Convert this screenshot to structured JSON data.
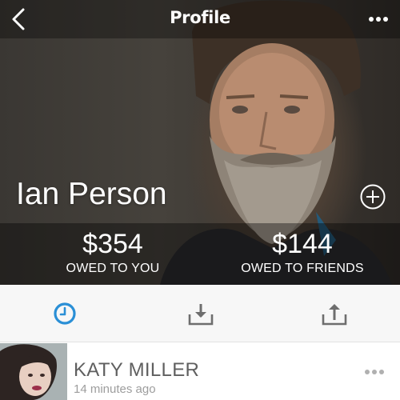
{
  "header": {
    "title": "Profile",
    "back_icon": "chevron-left-icon",
    "more_icon": "more-horizontal-icon"
  },
  "profile": {
    "name": "Ian Person",
    "add_icon": "plus-circle-icon",
    "owed_to_you": {
      "amount": "$354",
      "label": "OWED TO YOU"
    },
    "owed_to_friends": {
      "amount": "$144",
      "label": "OWED TO FRIENDS"
    }
  },
  "tabs": [
    {
      "id": "history",
      "icon": "clock-icon",
      "active": true
    },
    {
      "id": "received",
      "icon": "tray-download-icon",
      "active": false
    },
    {
      "id": "sent",
      "icon": "tray-upload-icon",
      "active": false
    }
  ],
  "list": {
    "items": [
      {
        "name": "KATY MILLER",
        "time": "14 minutes ago",
        "more_icon": "more-horizontal-icon"
      }
    ]
  },
  "colors": {
    "accent": "#2a8fd6",
    "icon_gray": "#6e6e6e",
    "tab_bar_bg": "#f7f7f7",
    "text_dark": "#5f5f5f",
    "text_light": "#9d9d9d"
  }
}
